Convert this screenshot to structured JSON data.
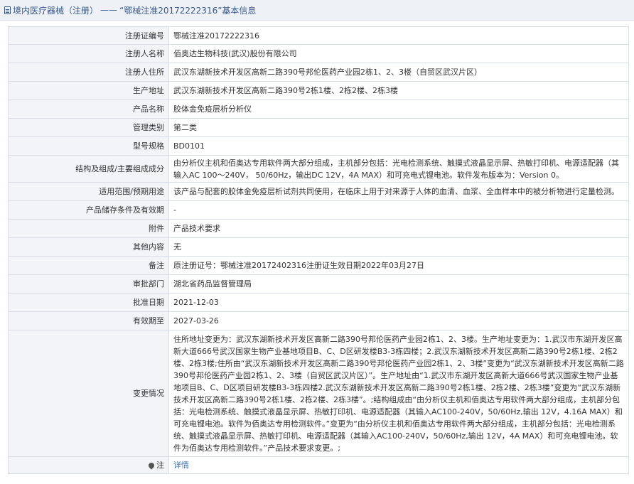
{
  "header": {
    "section": "境内医疗器械（注册）",
    "separator": "——",
    "record_title": "“鄂械注准20172222316”基本信息"
  },
  "fields": {
    "reg_no": {
      "label": "注册证编号",
      "value": "鄂械注准20172222316"
    },
    "registrant": {
      "label": "注册人名称",
      "value": "佰奥达生物科技(武汉)股份有限公司"
    },
    "registrant_address": {
      "label": "注册人住所",
      "value": "武汉东湖新技术开发区高新二路390号邦伦医药产业园2栋1、2、3楼（自贸区武汉片区）"
    },
    "production_address": {
      "label": "生产地址",
      "value": "武汉东湖新技术开发区高新二路390号2栋1楼、2栋2楼、2栋3楼"
    },
    "product_name": {
      "label": "产品名称",
      "value": "胶体金免疫层析分析仪"
    },
    "mgmt_class": {
      "label": "管理类别",
      "value": "第二类"
    },
    "model": {
      "label": "型号规格",
      "value": "BD0101"
    },
    "composition": {
      "label": "结构及组成/主要组成成分",
      "value": "由分析仪主机和佰奥达专用软件两大部分组成，主机部分包括：光电检测系统、触摸式液晶显示屏、热敏打印机、电源适配器（其输入AC 100～240V， 50/60Hz，输出DC 12V，4A MAX）和可充电式锂电池。软件发布版本为：Version 0。"
    },
    "scope": {
      "label": "适用范围/预期用途",
      "value": "该产品与配套的胶体金免疫层析试剂共同使用，在临床上用于对来源于人体的血清、血浆、全血样本中的被分析物进行定量检测。"
    },
    "storage": {
      "label": "产品储存条件及有效期",
      "value": "-"
    },
    "attachment": {
      "label": "附件",
      "value": "产品技术要求"
    },
    "other": {
      "label": "其他内容",
      "value": "无"
    },
    "remark": {
      "label": "备注",
      "value": "原注册证号：鄂械注准20172402316注册证生效日期2022年03月27日"
    },
    "approval_dept": {
      "label": "审批部门",
      "value": "湖北省药品监督管理局"
    },
    "approval_date": {
      "label": "批准日期",
      "value": "2021-12-03"
    },
    "expiry_date": {
      "label": "有效期至",
      "value": "2027-03-26"
    },
    "changes": {
      "label": "变更情况",
      "value": "住所地址变更为：武汉东湖新技术开发区高新二路390号邦伦医药产业园2栋1、2、3楼。生产地址变更为：1.武汉市东湖开发区高新大道666号武汉国家生物产业基地项目B、C、D区研发楼B3-3栋四楼；2.武汉东湖新技术开发区高新二路390号2栋1楼、2栋2楼、2栋3楼;住所由“武汉东湖新技术开发区高新二路390号邦伦医药产业园2栋1、2、3楼”变更为“武汉东湖新技术开发区高新二路390号邦伦医药产业园2栋1、2、3楼（自贸区武汉片区）”。生产地址由“1.武汉市东湖开发区高新大道666号武汉国家生物产业基地项目B、C、D区项目研发楼B3-3栋四楼2.武汉东湖新技术开发区高新二路390号2栋1楼、2栋2楼、2栋3楼”变更为“武汉东湖新技术开发区高新二路390号2栋1楼、2栋2楼、2栋3楼”。;结构组成由“由分析仪主机和佰奥达专用软件两大部分组成，主机部分包括：光电检测系统、触摸式液晶显示屏、热敏打印机、电源适配器（其输入AC100-240V，50/60Hz,输出 12V，4.16A MAX）和可充电锂电池。软件为佰奥达专用检测软件。”变更为“由分析仪主机和佰奥达专用软件两大部分组成，主机部分包括：光电检测系统、触摸式液晶显示屏、热敏打印机、电源适配器（其输入AC100-240V，50/60Hz,输出 12V，4A MAX）和可充电锂电池。软件为佰奥达专用检测软件。”产品技术要求变更。;"
    },
    "note": {
      "label": "注",
      "link": "详情"
    }
  }
}
